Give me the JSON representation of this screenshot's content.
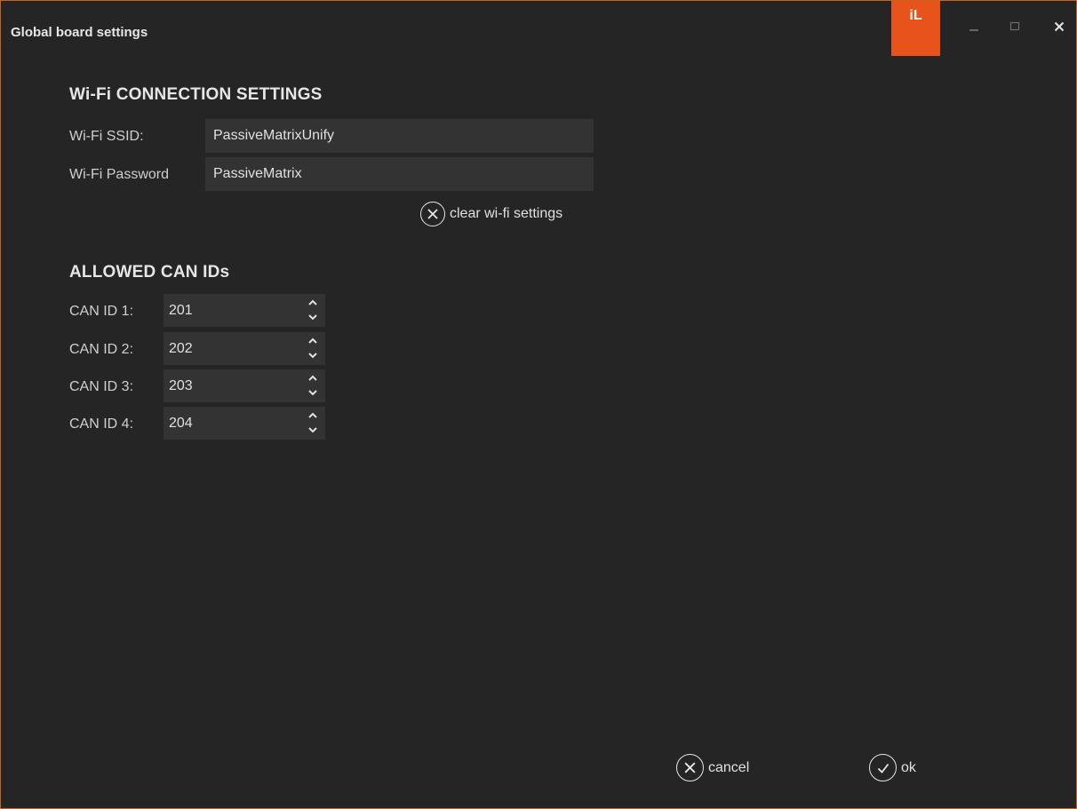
{
  "window": {
    "title": "Global board settings",
    "logo_text": "iL",
    "accent_color": "#e8531c"
  },
  "wifi": {
    "section_title": "Wi-Fi CONNECTION SETTINGS",
    "ssid_label": "Wi-Fi SSID:",
    "ssid_value": "PassiveMatrixUnify",
    "password_label": "Wi-Fi Password",
    "password_value": "PassiveMatrix",
    "clear_label": "clear wi-fi settings"
  },
  "can": {
    "section_title": "ALLOWED CAN IDs",
    "ids": [
      {
        "label": "CAN ID 1:",
        "value": "201"
      },
      {
        "label": "CAN ID 2:",
        "value": "202"
      },
      {
        "label": "CAN ID 3:",
        "value": "203"
      },
      {
        "label": "CAN ID 4:",
        "value": "204"
      }
    ]
  },
  "footer": {
    "cancel_label": "cancel",
    "ok_label": "ok"
  }
}
